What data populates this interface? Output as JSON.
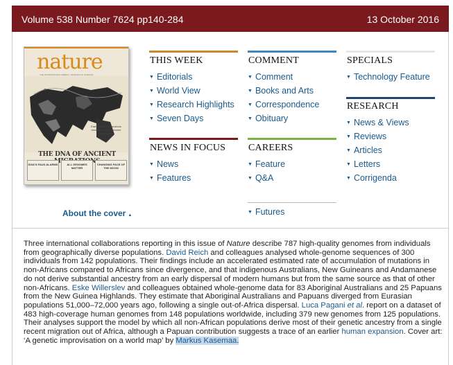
{
  "header": {
    "volume": "Volume 538 Number 7624 pp140-284",
    "date": "13 October 2016"
  },
  "cover": {
    "logo": "nature",
    "tagline": "THE INTERNATIONAL WEEKLY JOURNAL OF SCIENCE",
    "headline": "THE DNA OF ANCIENT MIGRATIONS",
    "teaser": "Early human expansions revealed in 787 genome sequences",
    "boxes": [
      "DIVA'S FAUX ALARMS",
      "ALL GENOMES MATTER",
      "CHANGING FACE OF THE MOON"
    ],
    "about_label": "About the cover"
  },
  "colors": {
    "topbar": "#7a1a1f",
    "this_week_rule": "#c8892e",
    "comment_rule": "#3f86bd",
    "specials_rule": "#e6e6e6",
    "research_rule": "#23446f",
    "news_rule": "#7a1a1f",
    "careers_rule": "#7ab443",
    "link": "#1a5a8c"
  },
  "this_week": {
    "title": "THIS WEEK",
    "items": [
      "Editorials",
      "World View",
      "Research Highlights",
      "Seven Days"
    ]
  },
  "comment": {
    "title": "COMMENT",
    "items": [
      "Comment",
      "Books and Arts",
      "Correspondence",
      "Obituary"
    ]
  },
  "specials": {
    "title": "SPECIALS",
    "items": [
      "Technology Feature"
    ]
  },
  "research": {
    "title": "RESEARCH",
    "items": [
      "News & Views",
      "Reviews",
      "Articles",
      "Letters",
      "Corrigenda"
    ]
  },
  "news_in_focus": {
    "title": "NEWS IN FOCUS",
    "items": [
      "News",
      "Features"
    ]
  },
  "careers": {
    "title": "CAREERS",
    "items": [
      "Feature",
      "Q&A"
    ],
    "extra": "Futures"
  },
  "summary": {
    "p1": "Three international collaborations reporting in this issue of ",
    "journal": "Nature",
    "p2": " describe 787 high-quality genomes from individuals from geographically diverse populations. ",
    "link1": "David Reich",
    "p3": " and colleagues analysed whole-genome sequences of 300 individuals from 142 populations. Their findings include an accelerated estimated rate of accumulation of mutations in non-Africans compared to Africans since divergence, and that indigenous Australians, New Guineans and Andamanese do not derive substantial ancestry from an early dispersal of modern humans but from the same source as that of other non-Africans. ",
    "link2": "Eske Willerslev",
    "p4": " and colleagues obtained whole-genome data for 83 Aboriginal Australians and 25 Papuans from the New Guinea Highlands. They estimate that Aboriginal Australians and Papuans diverged from Eurasian populations 51,000–72,000 years ago, following a single out-of-Africa dispersal. ",
    "link3": "Luca Pagani ",
    "link3_em": "et al",
    "p5": ". report on a dataset of 483 high-coverage human genomes from 148 populations worldwide, including 379 new genomes from 125 populations. Their analyses support the model by which all non-African populations derive most of their genetic ancestry from a single recent migration out of Africa, although a Papuan contribution suggests a trace of an earlier ",
    "link4": "human expansion",
    "p6": ". Cover art: ‘A genetic improvisation on a world map’ by ",
    "link5": "Markus Kasemaa",
    "p7": "."
  }
}
